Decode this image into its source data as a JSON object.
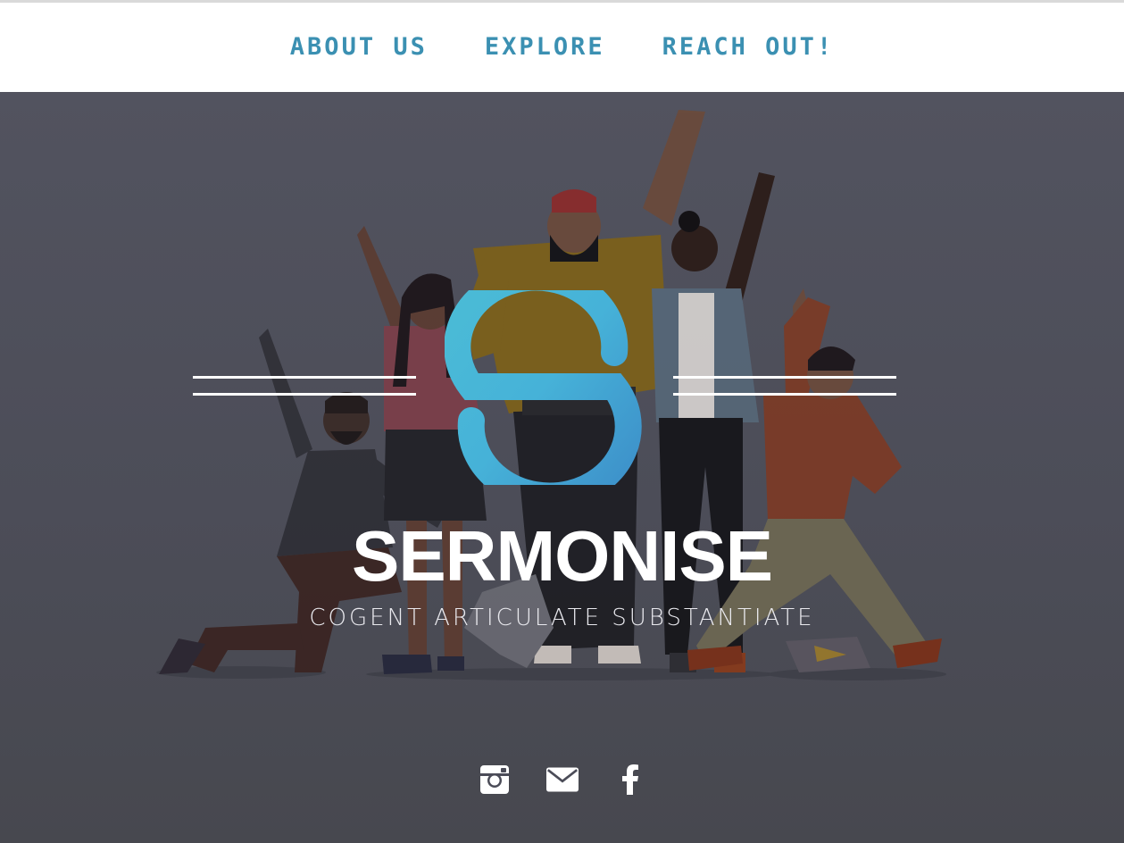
{
  "nav": {
    "items": [
      {
        "label": "ABOUT US"
      },
      {
        "label": "EXPLORE"
      },
      {
        "label": "REACH OUT!"
      }
    ]
  },
  "hero": {
    "brand": "SERMONISE",
    "tagline": "COGENT ARTICULATE SUBSTANTIATE"
  },
  "social": [
    {
      "icon": "instagram-icon"
    },
    {
      "icon": "mail-icon"
    },
    {
      "icon": "facebook-icon"
    }
  ],
  "colors": {
    "nav_text": "#3b90b2",
    "hero_bg": "#4b4c58",
    "logo_light": "#4bbcd6",
    "logo_dark": "#3d8fc9"
  }
}
